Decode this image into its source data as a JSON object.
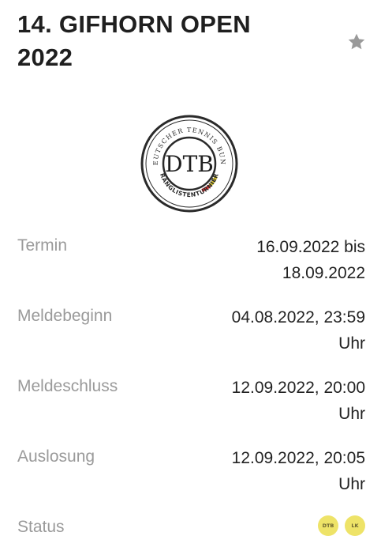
{
  "tournament": {
    "title": "14. GIFHORN OPEN 2022",
    "logo": {
      "ring_text_top": "DEUTSCHER TENNIS BUND",
      "ring_text_bottom": "RANGLISTENTURNIER",
      "center_text": "DTB"
    }
  },
  "details": [
    {
      "label": "Termin",
      "value": "16.09.2022 bis 18.09.2022"
    },
    {
      "label": "Meldebeginn",
      "value": "04.08.2022, 23:59 Uhr"
    },
    {
      "label": "Meldeschluss",
      "value": "12.09.2022, 20:00 Uhr"
    },
    {
      "label": "Auslosung",
      "value": "12.09.2022, 20:05 Uhr"
    }
  ],
  "status": {
    "label": "Status",
    "badges": [
      "DTB",
      "LK"
    ],
    "badge_color": "#eee368"
  },
  "icons": {
    "favorite": "star-icon"
  },
  "colors": {
    "label": "#9a9a9a",
    "text": "#222222",
    "star": "#9a9a9a"
  }
}
